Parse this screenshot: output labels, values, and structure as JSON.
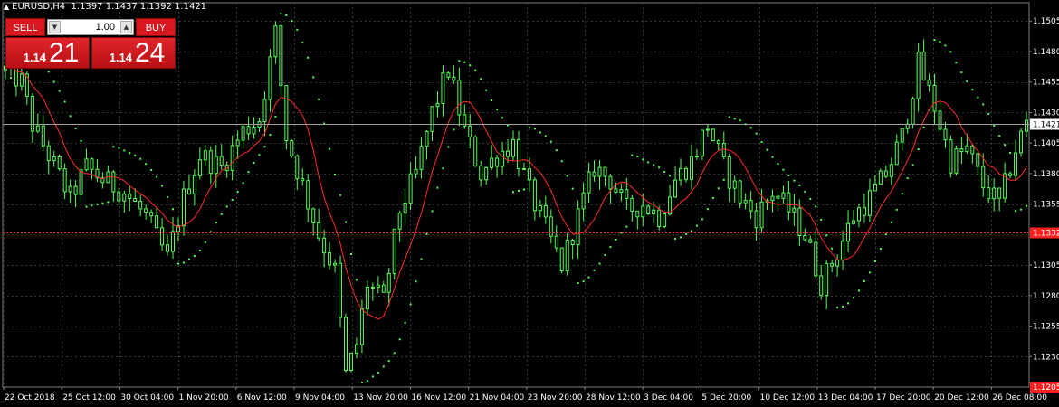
{
  "header": {
    "symbol_info": "EURUSD,H4",
    "ohlc": "1.1397 1.1437 1.1392 1.1421",
    "collapse_icon": "triangle-up-icon"
  },
  "trade_panel": {
    "sell_label": "SELL",
    "buy_label": "BUY",
    "lot_value": "1.00",
    "sell_price_prefix": "1.14",
    "sell_price_big": "21",
    "buy_price_prefix": "1.14",
    "buy_price_big": "24",
    "colors": {
      "button": "#d8181e"
    }
  },
  "chart_data": {
    "type": "line",
    "series": [
      {
        "name": "",
        "style": "candles",
        "color": "#55ff55"
      },
      {
        "name": "",
        "style": "line",
        "color": "#ff2a2a"
      },
      {
        "name": "",
        "style": "dots",
        "color": "#55ff55"
      }
    ],
    "x_ticks": [
      "22 Oct 2018",
      "25 Oct 12:00",
      "30 Oct 04:00",
      "1 Nov 20:00",
      "6 Nov 12:00",
      "9 Nov 04:00",
      "13 Nov 20:00",
      "16 Nov 12:00",
      "21 Nov 04:00",
      "23 Nov 20:00",
      "28 Nov 12:00",
      "3 Dec 04:00",
      "5 Dec 20:00",
      "10 Dec 12:00",
      "13 Dec 04:00",
      "17 Dec 20:00",
      "20 Dec 12:00",
      "26 Dec 08:00"
    ],
    "y_ticks": [
      1.1505,
      1.148,
      1.1455,
      1.143,
      1.1405,
      1.138,
      1.1355,
      1.1305,
      1.128,
      1.1255,
      1.123
    ],
    "y_tick_labels": [
      "1.1505",
      "1.1480",
      "1.1455",
      "1.1430",
      "1.1405",
      "1.1380",
      "1.1355",
      "1.1305",
      "1.1280",
      "1.1255",
      "1.1230"
    ],
    "ylim": [
      1.1205,
      1.152
    ],
    "current_price": 1.1421,
    "current_price_label": "1.1421",
    "horizontal_line": {
      "value": 1.1332,
      "label": "1.1332",
      "color": "#ff2020"
    },
    "bottom_label": "1.1205",
    "close_path": [
      [
        0,
        1.1465
      ],
      [
        3,
        1.1455
      ],
      [
        5,
        1.142
      ],
      [
        8,
        1.1395
      ],
      [
        12,
        1.136
      ],
      [
        15,
        1.1385
      ],
      [
        18,
        1.1375
      ],
      [
        22,
        1.1365
      ],
      [
        26,
        1.1345
      ],
      [
        30,
        1.131
      ],
      [
        33,
        1.136
      ],
      [
        36,
        1.1395
      ],
      [
        40,
        1.1385
      ],
      [
        44,
        1.1415
      ],
      [
        47,
        1.1425
      ],
      [
        50,
        1.1495
      ],
      [
        52,
        1.141
      ],
      [
        55,
        1.137
      ],
      [
        58,
        1.133
      ],
      [
        61,
        1.13
      ],
      [
        63,
        1.1215
      ],
      [
        65,
        1.124
      ],
      [
        67,
        1.129
      ],
      [
        70,
        1.1275
      ],
      [
        73,
        1.135
      ],
      [
        76,
        1.138
      ],
      [
        79,
        1.143
      ],
      [
        82,
        1.1465
      ],
      [
        85,
        1.1415
      ],
      [
        88,
        1.138
      ],
      [
        91,
        1.1395
      ],
      [
        94,
        1.1405
      ],
      [
        97,
        1.1365
      ],
      [
        100,
        1.1335
      ],
      [
        103,
        1.1305
      ],
      [
        106,
        1.1345
      ],
      [
        109,
        1.1385
      ],
      [
        112,
        1.1375
      ],
      [
        115,
        1.135
      ],
      [
        118,
        1.1355
      ],
      [
        121,
        1.1345
      ],
      [
        124,
        1.1375
      ],
      [
        127,
        1.139
      ],
      [
        130,
        1.142
      ],
      [
        133,
        1.1385
      ],
      [
        136,
        1.136
      ],
      [
        139,
        1.1345
      ],
      [
        142,
        1.1365
      ],
      [
        145,
        1.135
      ],
      [
        148,
        1.133
      ],
      [
        151,
        1.129
      ],
      [
        154,
        1.1315
      ],
      [
        157,
        1.1345
      ],
      [
        160,
        1.136
      ],
      [
        163,
        1.138
      ],
      [
        166,
        1.141
      ],
      [
        169,
        1.147
      ],
      [
        172,
        1.1435
      ],
      [
        175,
        1.139
      ],
      [
        178,
        1.14
      ],
      [
        181,
        1.137
      ],
      [
        184,
        1.1355
      ],
      [
        187,
        1.14
      ],
      [
        189,
        1.1421
      ]
    ]
  }
}
